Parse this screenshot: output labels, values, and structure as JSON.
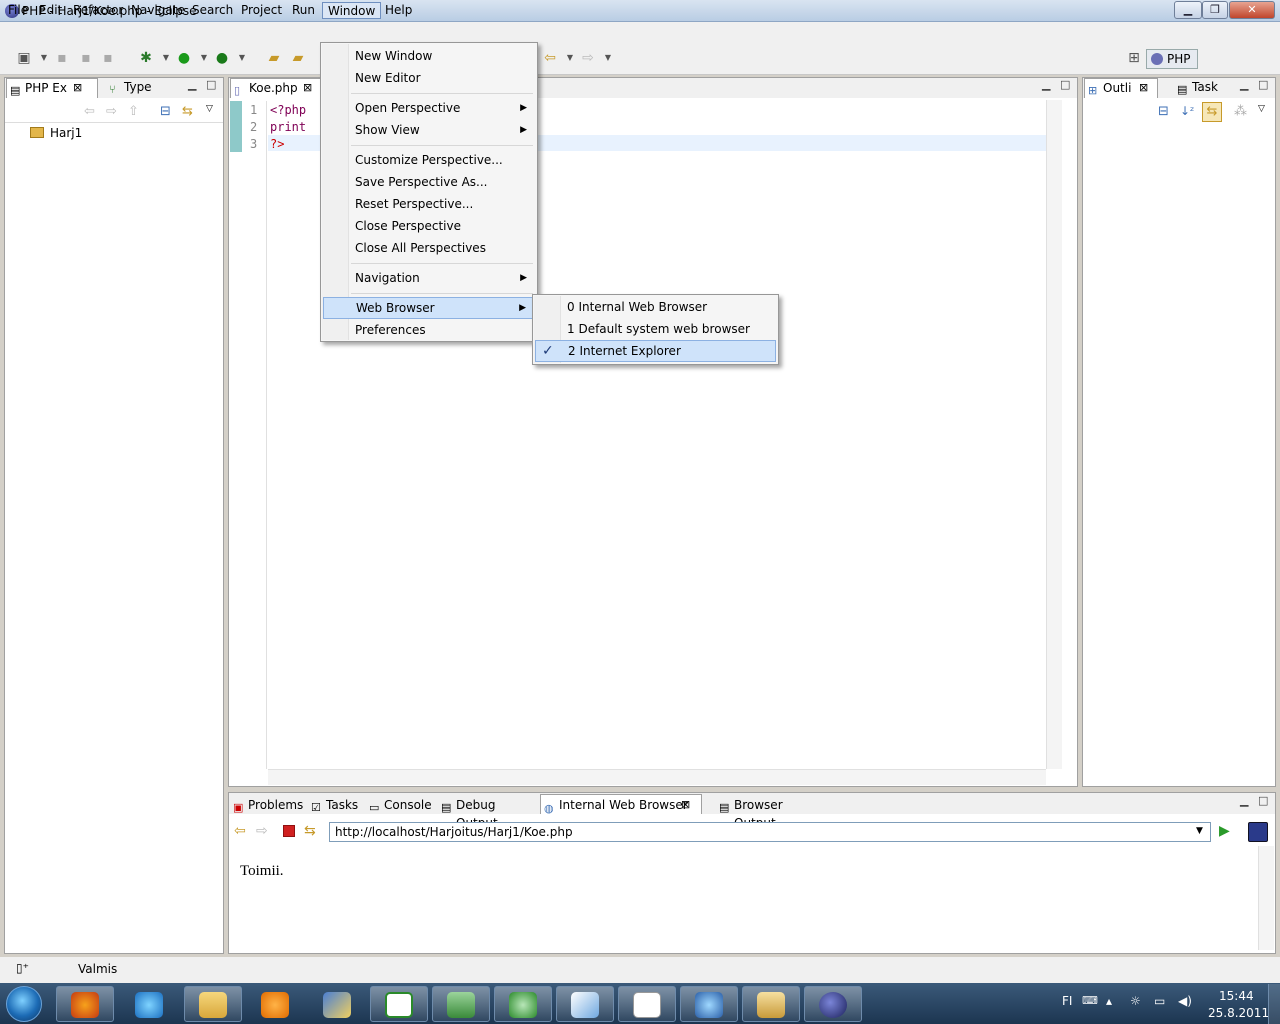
{
  "window": {
    "title": "PHP - Harj1/Koe.php - Eclipse",
    "controls": {
      "minimize": "▁",
      "maximize": "❐",
      "close": "✕"
    }
  },
  "menubar": [
    "File",
    "Edit",
    "Refactor",
    "Navigate",
    "Search",
    "Project",
    "Run",
    "Window",
    "Help"
  ],
  "perspective": {
    "label": "PHP"
  },
  "left_panel": {
    "tabs": [
      "PHP Ex",
      "Type"
    ],
    "tree": [
      "Harj1"
    ]
  },
  "editor": {
    "tab": "Koe.php",
    "line_numbers": [
      "1",
      "2",
      "3"
    ],
    "lines": [
      "<?php",
      "print",
      "?>"
    ]
  },
  "right_panel": {
    "tabs": [
      "Outli",
      "Task"
    ]
  },
  "window_menu": {
    "items": [
      {
        "label": "New Window"
      },
      {
        "label": "New Editor"
      },
      {
        "label": "Open Perspective",
        "submenu": true
      },
      {
        "label": "Show View",
        "submenu": true
      },
      {
        "label": "Customize Perspective..."
      },
      {
        "label": "Save Perspective As..."
      },
      {
        "label": "Reset Perspective..."
      },
      {
        "label": "Close Perspective"
      },
      {
        "label": "Close All Perspectives"
      },
      {
        "label": "Navigation",
        "submenu": true
      },
      {
        "label": "Web Browser",
        "submenu": true,
        "highlighted": true
      },
      {
        "label": "Preferences"
      }
    ]
  },
  "web_browser_submenu": {
    "items": [
      {
        "label": "0 Internal Web Browser",
        "checked": false
      },
      {
        "label": "1 Default system web browser",
        "checked": false
      },
      {
        "label": "2 Internet Explorer",
        "checked": true,
        "highlighted": true
      }
    ],
    "check_glyph": "✓"
  },
  "bottom_panel": {
    "tabs": [
      "Problems",
      "Tasks",
      "Console",
      "Debug Output",
      "Internal Web Browser",
      "Browser Output"
    ],
    "active_tab": "Internal Web Browser",
    "url": "http://localhost/Harjoitus/Harj1/Koe.php",
    "page_content": "Toimii."
  },
  "statusbar": {
    "text": "Valmis"
  },
  "taskbar": {
    "apps": [
      "firefox-icon",
      "ie-icon",
      "explorer-icon",
      "media-player-icon",
      "pencil-app-icon",
      "csharp-icon",
      "clipboard-icon",
      "green-arrow-icon",
      "notepad-icon",
      "odf-icon",
      "ie-refresh-icon",
      "network-icon",
      "eclipse-icon"
    ],
    "tray": {
      "language": "FI",
      "time": "15:44",
      "date": "25.8.2011"
    }
  }
}
